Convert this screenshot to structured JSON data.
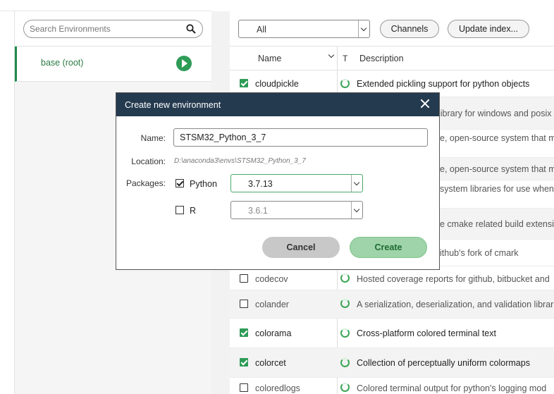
{
  "environments": {
    "search_placeholder": "Search Environments",
    "items": [
      {
        "label": "base (root)",
        "active": true
      }
    ]
  },
  "toolbar": {
    "filter_value": "All",
    "channels_label": "Channels",
    "update_label": "Update index..."
  },
  "table": {
    "headers": {
      "name": "Name",
      "type": "T",
      "description": "Description"
    },
    "rows": [
      {
        "name": "cloudpickle",
        "checked": true,
        "description": "Extended pickling support for python objects"
      },
      {
        "name": "codecov",
        "checked": false,
        "description": "Hosted coverage reports for github, bitbucket and"
      },
      {
        "name": "colander",
        "checked": false,
        "description": "A serialization, deserialization, and validation librar"
      },
      {
        "name": "colorama",
        "checked": true,
        "description": "Cross-platform colored terminal text"
      },
      {
        "name": "colorcet",
        "checked": true,
        "description": "Collection of perceptually uniform colormaps"
      },
      {
        "name": "coloredlogs",
        "checked": false,
        "description": "Colored terminal output for python's logging mod"
      }
    ],
    "partial_descriptions": [
      "library for windows and posix",
      "e, open-source system that m",
      "e, open-source system that m",
      "system libraries for use when",
      "e cmake related build extensio",
      "ithub's fork of cmark"
    ]
  },
  "dialog": {
    "title": "Create new environment",
    "name_label": "Name:",
    "name_value": "STSM32_Python_3_7",
    "location_label": "Location:",
    "location_value": "D:\\anaconda3\\envs\\STSM32_Python_3_7",
    "packages_label": "Packages:",
    "python": {
      "label": "Python",
      "checked": true,
      "version": "3.7.13"
    },
    "r": {
      "label": "R",
      "checked": false,
      "version": "3.6.1"
    },
    "cancel_label": "Cancel",
    "create_label": "Create"
  },
  "colors": {
    "accent_green": "#2e9c57",
    "dialog_titlebar": "#243a4f",
    "create_button": "#9fd3a9"
  }
}
